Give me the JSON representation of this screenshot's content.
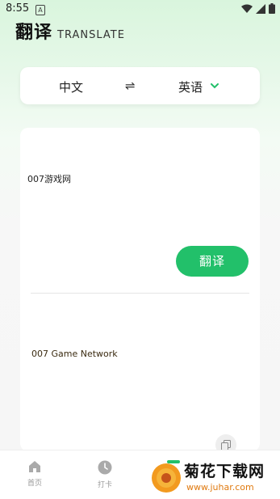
{
  "status_bar": {
    "time": "8:55",
    "notification_letter": "A"
  },
  "header": {
    "title": "翻译",
    "subtitle": "TRANSLATE"
  },
  "language_bar": {
    "source": "中文",
    "swap_symbol": "⇌",
    "target": "英语"
  },
  "input": {
    "text": "007游戏网"
  },
  "translate_button": {
    "label": "翻译"
  },
  "output": {
    "text": "007 Game Network"
  },
  "tabs": [
    {
      "label": "首页",
      "icon": "home-icon"
    },
    {
      "label": "打卡",
      "icon": "clock-icon"
    }
  ],
  "watermark": {
    "name": "菊花下载网",
    "url": "www.juhar.com"
  },
  "colors": {
    "accent": "#22c06a",
    "background_top": "#d9f5dd",
    "card": "#ffffff"
  }
}
